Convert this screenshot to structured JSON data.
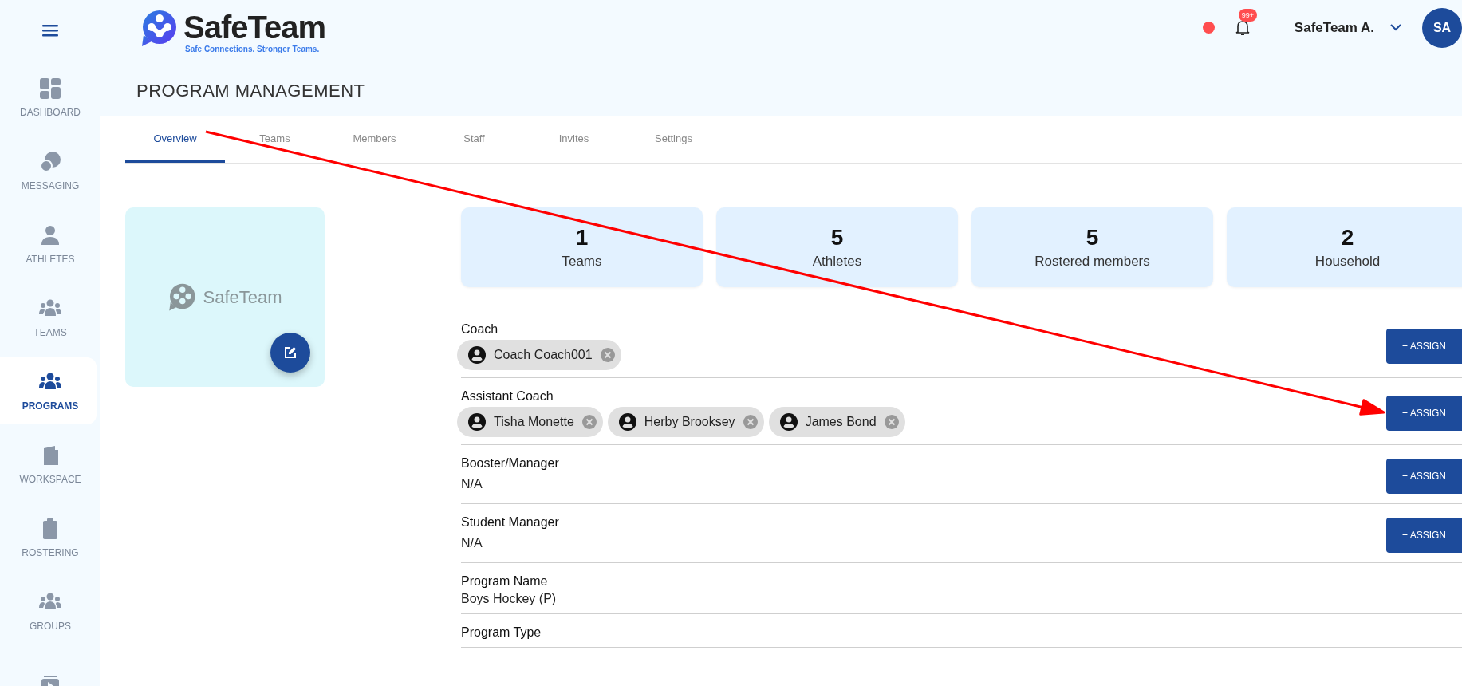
{
  "brand": {
    "name": "SafeTeam",
    "tagline": "Safe Connections. Stronger Teams."
  },
  "header": {
    "notification_badge": "99+",
    "user_name": "SafeTeam A.",
    "avatar_initials": "SA"
  },
  "sidebar": {
    "items": [
      {
        "label": "DASHBOARD",
        "selected": false
      },
      {
        "label": "MESSAGING",
        "selected": false
      },
      {
        "label": "ATHLETES",
        "selected": false
      },
      {
        "label": "TEAMS",
        "selected": false
      },
      {
        "label": "PROGRAMS",
        "selected": true
      },
      {
        "label": "WORKSPACE",
        "selected": false
      },
      {
        "label": "ROSTERING",
        "selected": false
      },
      {
        "label": "GROUPS",
        "selected": false
      },
      {
        "selected": false
      }
    ]
  },
  "page_title": "PROGRAM MANAGEMENT",
  "tabs": [
    {
      "label": "Overview",
      "selected": true
    },
    {
      "label": "Teams",
      "selected": false
    },
    {
      "label": "Members",
      "selected": false
    },
    {
      "label": "Staff",
      "selected": false
    },
    {
      "label": "Invites",
      "selected": false
    },
    {
      "label": "Settings",
      "selected": false
    }
  ],
  "program_image": {
    "logo_text": "SafeTeam"
  },
  "stats": [
    {
      "value": "1",
      "label": "Teams"
    },
    {
      "value": "5",
      "label": "Athletes"
    },
    {
      "value": "5",
      "label": "Rostered members"
    },
    {
      "value": "2",
      "label": "Household"
    }
  ],
  "fields": [
    {
      "kind": "people",
      "label": "Coach",
      "people": [
        "Coach Coach001"
      ],
      "button": "+ ASSIGN"
    },
    {
      "kind": "people",
      "label": "Assistant Coach",
      "people": [
        "Tisha Monette",
        "Herby Brooksey",
        "James Bond"
      ],
      "button": "+ ASSIGN"
    },
    {
      "kind": "people",
      "label": "Booster/Manager",
      "value": "N/A",
      "button": "+ ASSIGN"
    },
    {
      "kind": "people",
      "label": "Student Manager",
      "value": "N/A",
      "button": "+ ASSIGN"
    },
    {
      "kind": "text",
      "label": "Program Name",
      "value": "Boys Hockey (P)"
    },
    {
      "kind": "text",
      "label": "Program Type"
    }
  ]
}
